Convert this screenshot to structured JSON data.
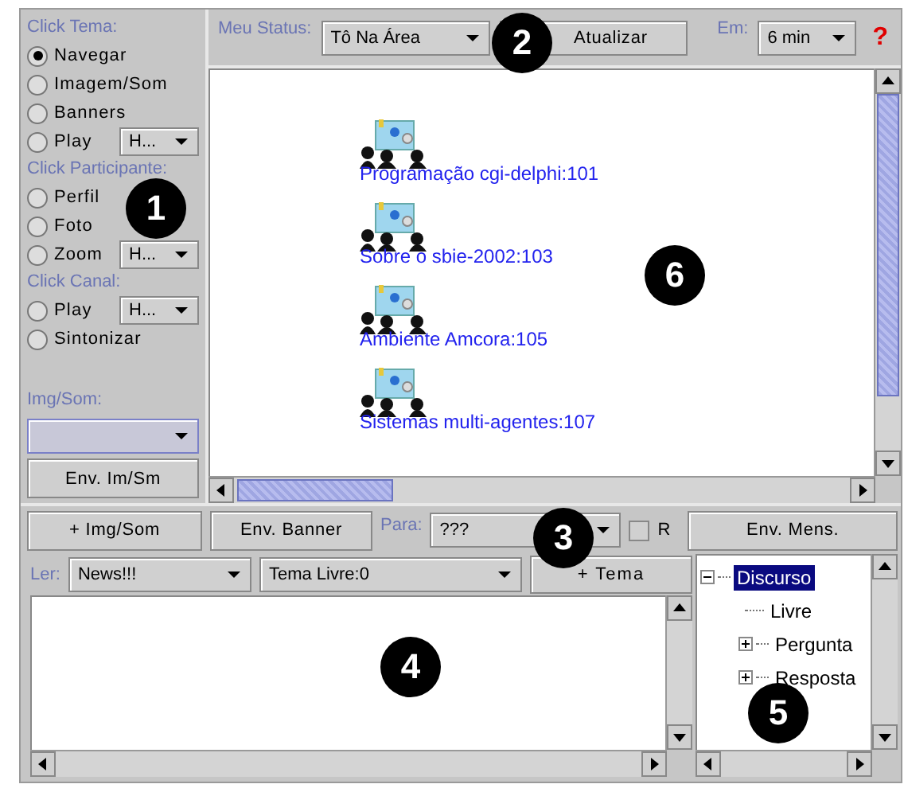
{
  "left_panel": {
    "groups": [
      {
        "label": "Click Tema:",
        "options": [
          {
            "label": "Navegar",
            "selected": true
          },
          {
            "label": "Imagem/Som",
            "selected": false
          },
          {
            "label": "Banners",
            "selected": false
          },
          {
            "label": "Play",
            "selected": false,
            "combo": "H..."
          }
        ]
      },
      {
        "label": "Click Participante:",
        "options": [
          {
            "label": "Perfil",
            "selected": false
          },
          {
            "label": "Foto",
            "selected": false
          },
          {
            "label": "Zoom",
            "selected": false,
            "combo": "H..."
          }
        ]
      },
      {
        "label": "Click Canal:",
        "options": [
          {
            "label": "Play",
            "selected": false,
            "combo": "H..."
          },
          {
            "label": "Sintonizar",
            "selected": false
          }
        ]
      }
    ],
    "media_label": "Img/Som:",
    "send_button": "Env. Im/Sm"
  },
  "status_bar": {
    "label": "Meu Status:",
    "status": "Tô Na Área",
    "update_button": "Atualizar",
    "interval_label": "Em:",
    "interval": "6 min",
    "help": "?"
  },
  "topics": [
    {
      "title": "Programação cgi-delphi:101"
    },
    {
      "title": "Sobre o sbie-2002:103"
    },
    {
      "title": "Ambiente Amcora:105"
    },
    {
      "title": "Sistemas multi-agentes:107"
    }
  ],
  "toolbar": {
    "add_media": "+ Img/Som",
    "send_banner": "Env. Banner",
    "to_label": "Para:",
    "to": "???",
    "r_checkbox": {
      "label": "R",
      "checked": false
    },
    "send_message": "Env. Mens."
  },
  "reader": {
    "label": "Ler:",
    "source": "News!!!",
    "theme": "Tema Livre:0",
    "add_theme": "+ Tema"
  },
  "tree": [
    {
      "label": "Discurso",
      "expanded": true,
      "selected": true,
      "children": [
        {
          "label": "Livre",
          "selected": false
        },
        {
          "label": "Pergunta",
          "expanded": false,
          "selected": false
        },
        {
          "label": "Resposta",
          "expanded": false,
          "selected": false
        }
      ]
    }
  ],
  "callouts": [
    "1",
    "2",
    "3",
    "4",
    "5",
    "6"
  ]
}
